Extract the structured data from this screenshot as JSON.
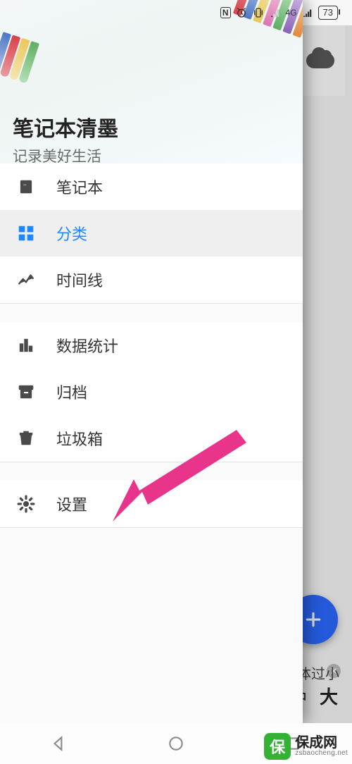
{
  "status": {
    "nfc": "N",
    "network_label": "4G",
    "battery_pct": "73"
  },
  "header": {
    "title": "笔记本清墨",
    "subtitle": "记录美好生活"
  },
  "menu": {
    "notebook": "笔记本",
    "category": "分类",
    "timeline": "时间线",
    "stats": "数据统计",
    "archive": "归档",
    "trash": "垃圾箱",
    "settings": "设置"
  },
  "background": {
    "tip_text": "体过小",
    "size_mid": "中",
    "size_big": "大",
    "fab_plus": "+",
    "close_x": "✕"
  },
  "watermark": {
    "badge": "保",
    "name": "保成网",
    "url": "zsbaocheng.net"
  }
}
